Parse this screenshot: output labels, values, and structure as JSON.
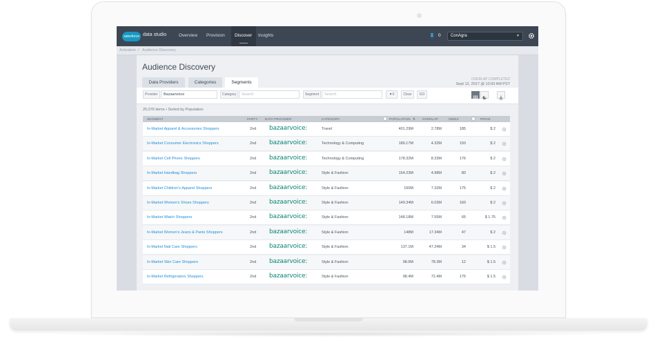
{
  "nav": {
    "logo_text": "salesforce",
    "brand": "data studio",
    "items": [
      {
        "label": "Overview"
      },
      {
        "label": "Provision"
      },
      {
        "label": "Discover"
      },
      {
        "label": "Insights"
      }
    ],
    "pin_count": "0",
    "org": "ConAgra"
  },
  "breadcrumb": [
    "Activation",
    "/",
    "Audience Discovery"
  ],
  "page_title": "Audience Discovery",
  "tabs": [
    {
      "label": "Data Providers"
    },
    {
      "label": "Categories"
    },
    {
      "label": "Segments"
    }
  ],
  "overlap": {
    "label": "OVERLAP COMPLETED",
    "date": "Sept 12, 2017 @ 10:00 AM PST"
  },
  "filters": {
    "provider_label": "Provider",
    "provider_value": "Bazaarvoice",
    "category_label": "Category",
    "category_placeholder": "Search",
    "segment_label": "Segment",
    "segment_placeholder": "Search",
    "filter_count": "0",
    "clear_label": "Clear",
    "go_label": "GO"
  },
  "summary": "25,076 items • Sorted by Population",
  "table": {
    "headers": {
      "segment": "SEGMENT",
      "party": "PARTY",
      "provider": "DATA PROVIDER",
      "category": "CATEGORY",
      "population": "POPULATION",
      "overlap": "OVERLAP",
      "index": "INDEX",
      "price": "PRICE"
    },
    "rows": [
      {
        "segment": "In-Market Apparel & Accessories Shoppers",
        "party": "2nd",
        "provider": "bazaarvoice:",
        "category": "Travel",
        "population": "401.29M",
        "overlap": "2.78M",
        "index": "185",
        "price": "$ 2"
      },
      {
        "segment": "In-Market Consumer Electronics Shoppers",
        "party": "2nd",
        "provider": "bazaarvoice:",
        "category": "Technology & Computing",
        "population": "189.17M",
        "overlap": "4.32M",
        "index": "150",
        "price": "$ 2"
      },
      {
        "segment": "In-Market Cell Phone Shoppers",
        "party": "2nd",
        "provider": "bazaarvoice:",
        "category": "Technology & Computing",
        "population": "178.32M",
        "overlap": "8.33M",
        "index": "176",
        "price": "$ 2"
      },
      {
        "segment": "In-Market Handbag Shoppers",
        "party": "2nd",
        "provider": "bazaarvoice:",
        "category": "Style & Fashion",
        "population": "154.23M",
        "overlap": "4.98M",
        "index": "80",
        "price": "$ 2"
      },
      {
        "segment": "In-Market Children's Apparel Shoppers",
        "party": "2nd",
        "provider": "bazaarvoice:",
        "category": "Style & Fashion",
        "population": "150M",
        "overlap": "7.32M",
        "index": "175",
        "price": "$ 2"
      },
      {
        "segment": "In-Market Women's Shoes Shoppers",
        "party": "2nd",
        "provider": "bazaarvoice:",
        "category": "Style & Fashion",
        "population": "149.34M",
        "overlap": "6.03M",
        "index": "160",
        "price": "$ 2"
      },
      {
        "segment": "In-Market Watch Shoppers",
        "party": "2nd",
        "provider": "bazaarvoice:",
        "category": "Style & Fashion",
        "population": "148.18M",
        "overlap": "7.55M",
        "index": "65",
        "price": "$ 1.75"
      },
      {
        "segment": "In-Market Women's Jeans & Pants Shoppers",
        "party": "2nd",
        "provider": "bazaarvoice:",
        "category": "Style & Fashion",
        "population": "148M",
        "overlap": "17.34M",
        "index": "47",
        "price": "$ 2"
      },
      {
        "segment": "In-Market Nail Care Shoppers",
        "party": "2nd",
        "provider": "bazaarvoice:",
        "category": "Style & Fashion",
        "population": "137.1M",
        "overlap": "47.24M",
        "index": "34",
        "price": "$ 1.5"
      },
      {
        "segment": "In-Market Skin Care Shoppers",
        "party": "2nd",
        "provider": "bazaarvoice:",
        "category": "Style & Fashion",
        "population": "98.6M",
        "overlap": "78.3M",
        "index": "12",
        "price": "$ 1.5"
      },
      {
        "segment": "In-Market Refrigerators Shoppers",
        "party": "2nd",
        "provider": "bazaarvoice:",
        "category": "Style & Fashion",
        "population": "98.4M",
        "overlap": "72.4M",
        "index": "175",
        "price": "$ 1.5"
      }
    ]
  }
}
